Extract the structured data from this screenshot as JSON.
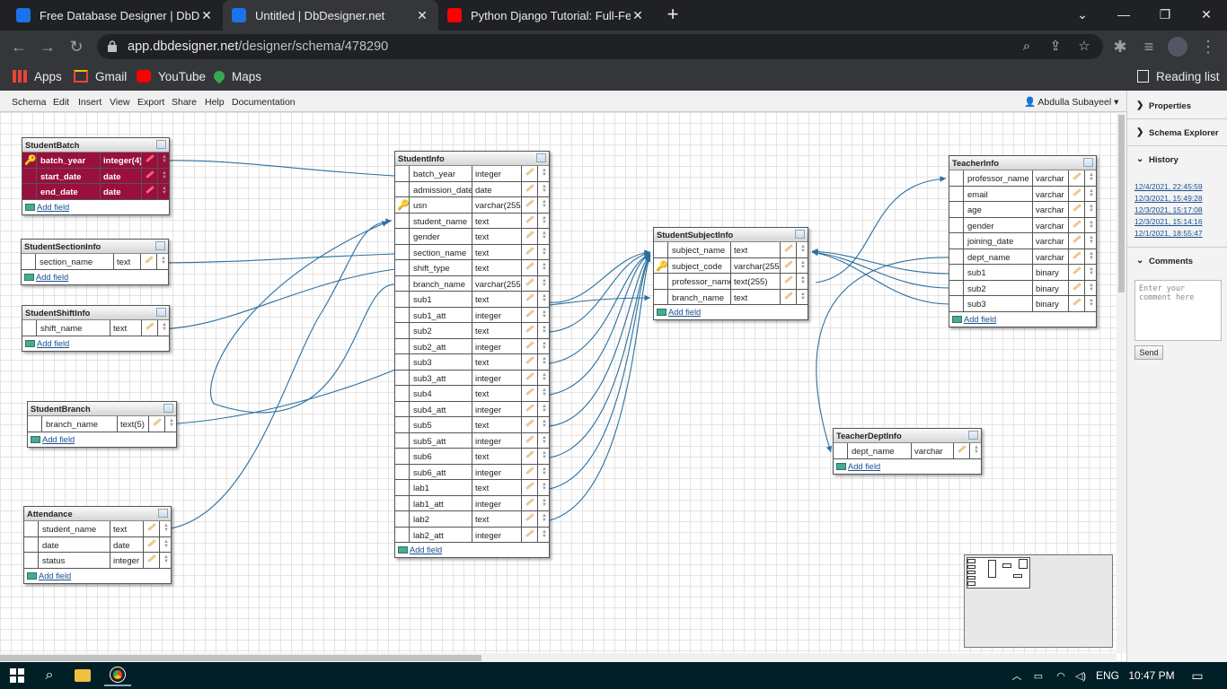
{
  "browser": {
    "tabs": [
      {
        "label": "Free Database Designer | DbDesi",
        "icon": "database-icon",
        "active": false
      },
      {
        "label": "Untitled | DbDesigner.net",
        "icon": "database-icon",
        "active": true
      },
      {
        "label": "Python Django Tutorial: Full-Feat",
        "icon": "youtube-icon",
        "active": false
      }
    ],
    "url_host": "app.dbdesigner.net",
    "url_path": "/designer/schema/478290",
    "bookmarks": [
      {
        "label": "Apps",
        "icon": "apps-grid-icon"
      },
      {
        "label": "Gmail",
        "icon": "gmail-icon"
      },
      {
        "label": "YouTube",
        "icon": "youtube-icon"
      },
      {
        "label": "Maps",
        "icon": "maps-pin-icon"
      }
    ],
    "reading_list": "Reading list"
  },
  "menu": {
    "items": [
      "Schema",
      "Edit",
      "Insert",
      "View",
      "Export",
      "Share",
      "Help",
      "Documentation"
    ],
    "user": "Abdulla Subayeel"
  },
  "tables": [
    {
      "name": "StudentBatch",
      "fields": [
        {
          "name": "batch_year",
          "type": "integer(4)",
          "pk": true
        },
        {
          "name": "start_date",
          "type": "date",
          "pk": true
        },
        {
          "name": "end_date",
          "type": "date",
          "pk": true
        }
      ]
    },
    {
      "name": "StudentSectionInfo",
      "fields": [
        {
          "name": "section_name",
          "type": "text"
        }
      ]
    },
    {
      "name": "StudentShiftInfo",
      "fields": [
        {
          "name": "shift_name",
          "type": "text"
        }
      ]
    },
    {
      "name": "StudentBranch",
      "fields": [
        {
          "name": "branch_name",
          "type": "text(5)"
        }
      ]
    },
    {
      "name": "Attendance",
      "fields": [
        {
          "name": "student_name",
          "type": "text"
        },
        {
          "name": "date",
          "type": "date"
        },
        {
          "name": "status",
          "type": "integer"
        }
      ]
    },
    {
      "name": "StudentInfo",
      "fields": [
        {
          "name": "batch_year",
          "type": "integer"
        },
        {
          "name": "admission_date",
          "type": "date"
        },
        {
          "name": "usn",
          "type": "varchar(255)",
          "key": true
        },
        {
          "name": "student_name",
          "type": "text"
        },
        {
          "name": "gender",
          "type": "text"
        },
        {
          "name": "section_name",
          "type": "text"
        },
        {
          "name": "shift_type",
          "type": "text"
        },
        {
          "name": "branch_name",
          "type": "varchar(255)"
        },
        {
          "name": "sub1",
          "type": "text"
        },
        {
          "name": "sub1_att",
          "type": "integer"
        },
        {
          "name": "sub2",
          "type": "text"
        },
        {
          "name": "sub2_att",
          "type": "integer"
        },
        {
          "name": "sub3",
          "type": "text"
        },
        {
          "name": "sub3_att",
          "type": "integer"
        },
        {
          "name": "sub4",
          "type": "text"
        },
        {
          "name": "sub4_att",
          "type": "integer"
        },
        {
          "name": "sub5",
          "type": "text"
        },
        {
          "name": "sub5_att",
          "type": "integer"
        },
        {
          "name": "sub6",
          "type": "text"
        },
        {
          "name": "sub6_att",
          "type": "integer"
        },
        {
          "name": "lab1",
          "type": "text"
        },
        {
          "name": "lab1_att",
          "type": "integer"
        },
        {
          "name": "lab2",
          "type": "text"
        },
        {
          "name": "lab2_att",
          "type": "integer"
        }
      ]
    },
    {
      "name": "StudentSubjectInfo",
      "fields": [
        {
          "name": "subject_name",
          "type": "text"
        },
        {
          "name": "subject_code",
          "type": "varchar(255)",
          "key": true
        },
        {
          "name": "professor_name",
          "type": "text(255)"
        },
        {
          "name": "branch_name",
          "type": "text"
        }
      ]
    },
    {
      "name": "TeacherInfo",
      "fields": [
        {
          "name": "professor_name",
          "type": "varchar"
        },
        {
          "name": "email",
          "type": "varchar"
        },
        {
          "name": "age",
          "type": "varchar"
        },
        {
          "name": "gender",
          "type": "varchar"
        },
        {
          "name": "joining_date",
          "type": "varchar"
        },
        {
          "name": "dept_name",
          "type": "varchar"
        },
        {
          "name": "sub1",
          "type": "binary"
        },
        {
          "name": "sub2",
          "type": "binary"
        },
        {
          "name": "sub3",
          "type": "binary"
        }
      ]
    },
    {
      "name": "TeacherDeptInfo",
      "fields": [
        {
          "name": "dept_name",
          "type": "varchar"
        }
      ]
    }
  ],
  "add_field_label": "Add field",
  "panel": {
    "properties": "Properties",
    "schema_explorer": "Schema Explorer",
    "history": "History",
    "history_items": [
      "12/4/2021, 22:45:59",
      "12/3/2021, 15:49:28",
      "12/3/2021, 15:17:08",
      "12/3/2021, 15:14:16",
      "12/1/2021, 18:55:47"
    ],
    "comments": "Comments",
    "comment_placeholder": "Enter your comment here",
    "send": "Send"
  },
  "taskbar": {
    "lang": "ENG",
    "time": "10:47 PM"
  },
  "colors": {
    "primary_key": "#990f3d",
    "relation_line": "#2a6f9e",
    "link": "#1a4f8f"
  }
}
